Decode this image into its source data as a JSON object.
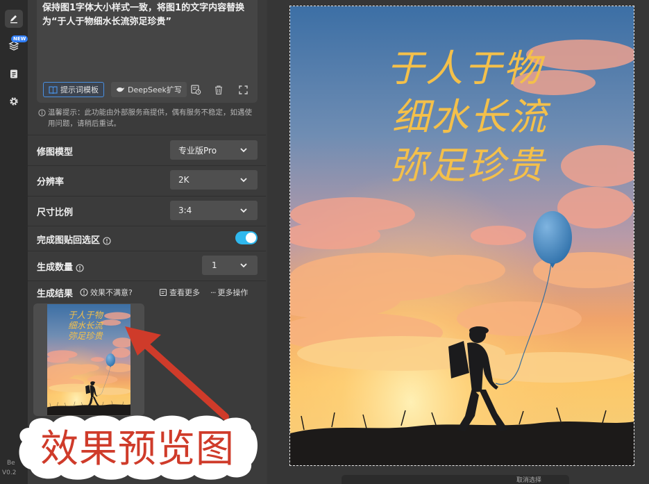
{
  "rail": {
    "new_badge": "NEW",
    "brand": "Be",
    "version": "V0.2"
  },
  "prompt": {
    "text": "保持图1字体大小样式一致，将图1的文字内容替换为“于人于物细水长流弥足珍贵”",
    "template_label": "提示词模板",
    "deepseek_label": "DeepSeek扩写"
  },
  "notice": "温馨提示：此功能由外部服务商提供，偶有服务不稳定，如遇使用问题，请稍后重试。",
  "settings": {
    "model_label": "修图模型",
    "model_value": "专业版Pro",
    "resolution_label": "分辨率",
    "resolution_value": "2K",
    "ratio_label": "尺寸比例",
    "ratio_value": "3:4",
    "paste_back_label": "完成图贴回选区",
    "paste_back_on": true,
    "count_label": "生成数量",
    "count_value": "1"
  },
  "result": {
    "label": "生成结果",
    "unsatisfied": "效果不满意?",
    "view_more": "查看更多",
    "more_ops": "更多操作"
  },
  "poster": {
    "line1": "于人于物",
    "line2": "细水长流",
    "line3": "弥足珍贵"
  },
  "annotation": {
    "text": "效果预览图",
    "color": "#cf3b2a"
  },
  "bottom_bar": {
    "label": "取消选择"
  },
  "colors": {
    "accent": "#2fb8ee",
    "template_border": "#4a90e2",
    "poster_text": "#f4c04a"
  }
}
